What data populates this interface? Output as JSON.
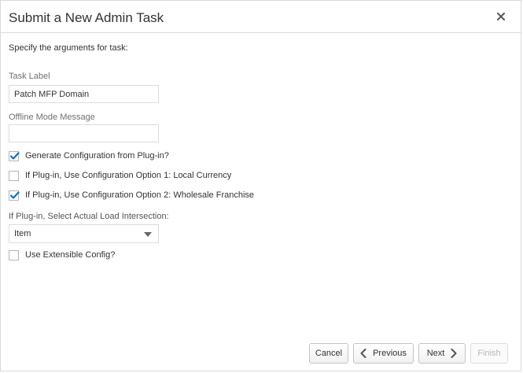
{
  "dialog": {
    "title": "Submit a New Admin Task",
    "instruction": "Specify the arguments for task:"
  },
  "fields": {
    "task_label": {
      "label": "Task Label",
      "value": "Patch MFP Domain"
    },
    "offline_message": {
      "label": "Offline Mode Message",
      "value": ""
    }
  },
  "checkboxes": [
    {
      "label": "Generate Configuration from Plug-in?",
      "checked": true
    },
    {
      "label": "If Plug-in, Use Configuration Option 1: Local Currency",
      "checked": false
    },
    {
      "label": "If Plug-in, Use Configuration Option 2: Wholesale Franchise",
      "checked": true
    }
  ],
  "load_intersection": {
    "label": "If Plug-in, Select Actual Load Intersection:",
    "value": "Item"
  },
  "extensible": {
    "label": "Use Extensible Config?",
    "checked": false
  },
  "buttons": {
    "cancel": "Cancel",
    "previous": "Previous",
    "next": "Next",
    "finish": "Finish"
  },
  "colors": {
    "check_blue": "#0572ce",
    "border": "#dcdcdc",
    "disabled_text": "#b8b8b8"
  },
  "icons": [
    "close-icon",
    "checkmark-icon",
    "caret-down-icon",
    "chevron-left-icon",
    "chevron-right-icon"
  ]
}
